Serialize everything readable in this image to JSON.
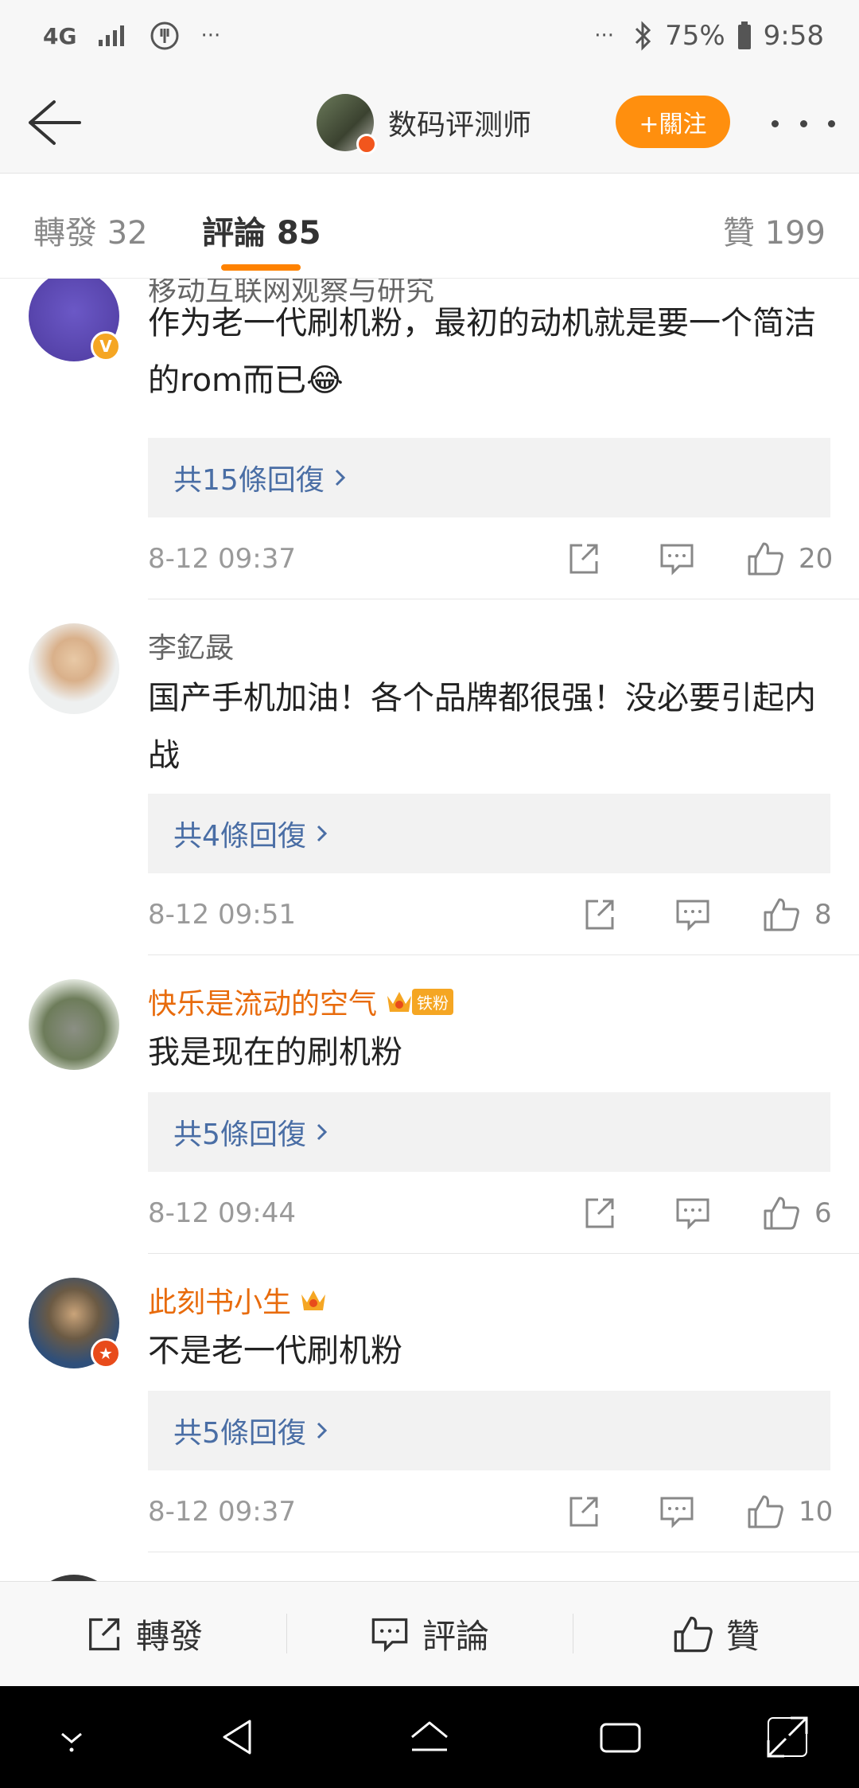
{
  "status_bar": {
    "network": "4G",
    "battery": "75%",
    "time": "9:58",
    "more_left": "···",
    "more_right": "···"
  },
  "header": {
    "title": "数码评测师",
    "follow_label": "+關注"
  },
  "tabs": {
    "repost": "轉發 32",
    "comment": "評論 85",
    "like": "贊 199"
  },
  "comments": [
    {
      "username": "移动互联网观察与研究",
      "text": "作为老一代刷机粉，最初的动机就是要一个简洁的rom而已😂",
      "replies": "共15條回復",
      "time": "8-12 09:37",
      "likes": "20"
    },
    {
      "username": "李釔晸",
      "text": "国产手机加油！各个品牌都很强！没必要引起内战",
      "replies": "共4條回復",
      "time": "8-12 09:51",
      "likes": "8"
    },
    {
      "username": "快乐是流动的空气",
      "fan_badge": "铁粉",
      "text": "我是现在的刷机粉",
      "replies": "共5條回復",
      "time": "8-12 09:44",
      "likes": "6"
    },
    {
      "username": "此刻书小生",
      "text": "不是老一代刷机粉",
      "replies": "共5條回復",
      "time": "8-12 09:37",
      "likes": "10"
    }
  ],
  "bottom_bar": {
    "repost": "轉發",
    "comment": "評論",
    "like": "贊"
  },
  "icons": {
    "back": "arrow-left-icon",
    "share": "share-icon",
    "comment": "comment-icon",
    "like": "thumbs-up-icon",
    "crown": "crown-icon"
  },
  "colors": {
    "accent": "#ff8200",
    "follow_button": "#ff8f0e",
    "reply_link": "#4a6ea5",
    "vip_name": "#e86b0c"
  }
}
